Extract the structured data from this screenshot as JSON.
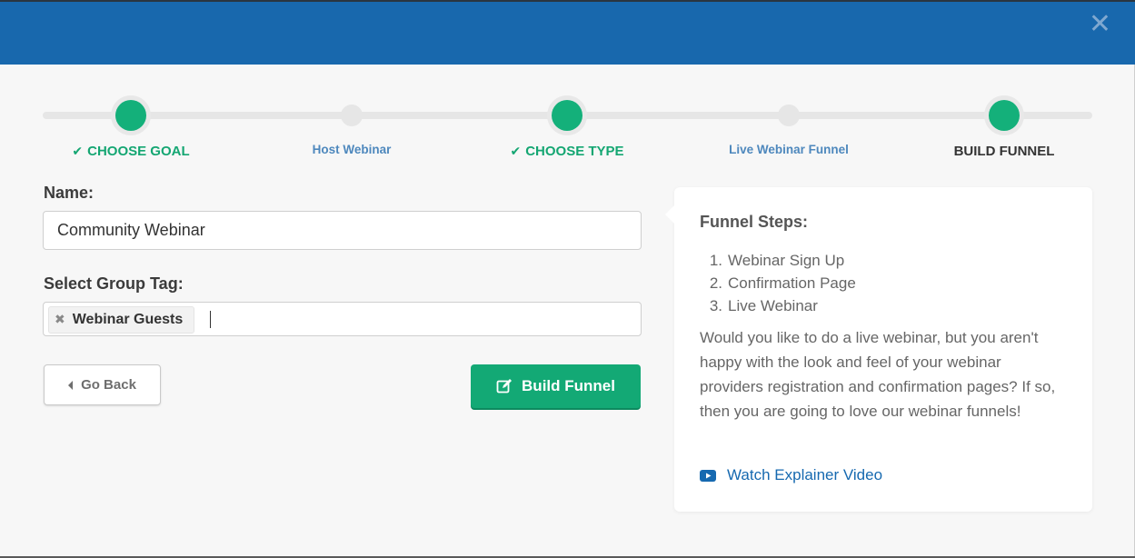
{
  "header": {
    "close_symbol": "✕"
  },
  "progress": {
    "steps": [
      {
        "label": "CHOOSE GOAL",
        "state": "done",
        "check": "✔"
      },
      {
        "label": "Host Webinar",
        "state": "sub"
      },
      {
        "label": "CHOOSE TYPE",
        "state": "done",
        "check": "✔"
      },
      {
        "label": "Live Webinar Funnel",
        "state": "sub"
      },
      {
        "label": "BUILD FUNNEL",
        "state": "current"
      }
    ]
  },
  "form": {
    "name_label": "Name:",
    "name_value": "Community Webinar",
    "tag_label": "Select Group Tag:",
    "tag_chip_remove": "✖",
    "tag_chip": "Webinar Guests"
  },
  "buttons": {
    "back_label": "Go Back",
    "build_label": "Build Funnel"
  },
  "panel": {
    "title": "Funnel Steps:",
    "steps": [
      {
        "num": "1.",
        "text": "Webinar Sign Up"
      },
      {
        "num": "2.",
        "text": "Confirmation Page"
      },
      {
        "num": "3.",
        "text": "Live Webinar"
      }
    ],
    "description": "Would you like to do a live webinar, but you aren't happy with the look and feel of your webinar providers registration and confirmation pages? If so, then you are going to love our webinar funnels!",
    "video_link": "Watch Explainer Video"
  },
  "colors": {
    "header": "#1868ad",
    "accent_green": "#13a975",
    "link_blue": "#1669b0"
  }
}
